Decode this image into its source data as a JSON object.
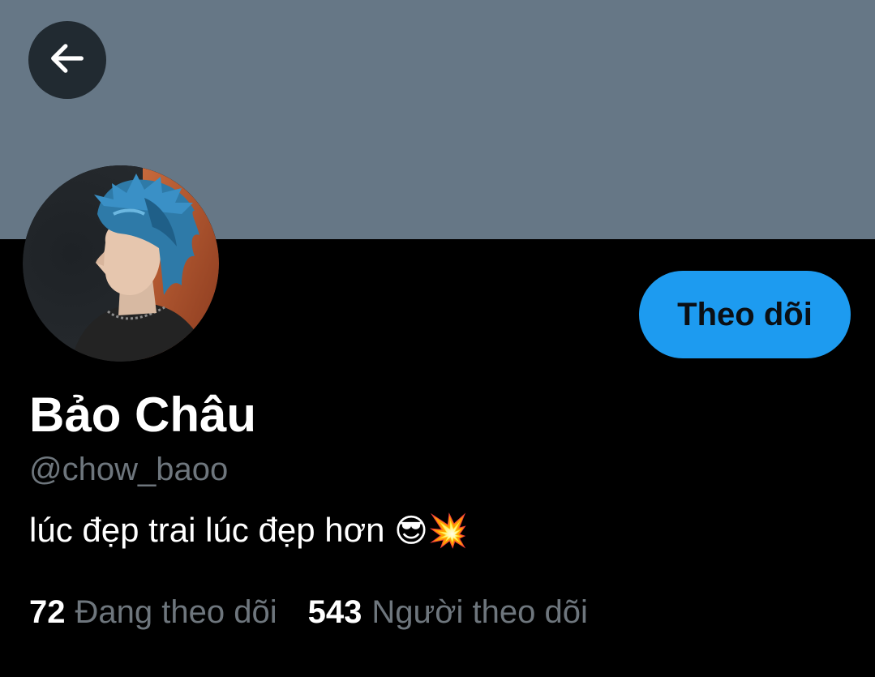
{
  "profile": {
    "display_name": "Bảo Châu",
    "handle": "@chow_baoo",
    "bio_text": "lúc đẹp trai lúc đẹp hơn",
    "bio_emojis": "😎💥"
  },
  "actions": {
    "follow_label": "Theo dõi"
  },
  "stats": {
    "following_count": "72",
    "following_label": "Đang theo dõi",
    "followers_count": "543",
    "followers_label": "Người theo dõi"
  },
  "icons": {
    "back": "arrow-left-icon"
  },
  "colors": {
    "banner": "#667786",
    "background": "#000000",
    "accent": "#1d9bf0",
    "secondary_text": "#6e767d"
  }
}
